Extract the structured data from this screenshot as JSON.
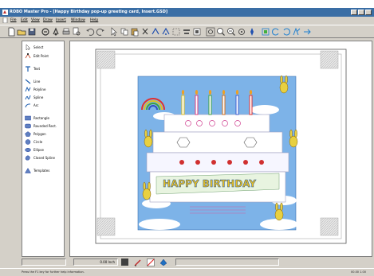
{
  "window": {
    "title": "ROBO Master Pro - [Happy Birthday pop-up greeting card, Insert.GSD]"
  },
  "menu": [
    {
      "key": "file",
      "label": "File"
    },
    {
      "key": "edit",
      "label": "Edit"
    },
    {
      "key": "view",
      "label": "View"
    },
    {
      "key": "draw",
      "label": "Draw"
    },
    {
      "key": "insert",
      "label": "Insert"
    },
    {
      "key": "window",
      "label": "Window"
    },
    {
      "key": "help",
      "label": "Help"
    }
  ],
  "toolbar": {
    "icons": [
      "new-file-icon",
      "open-folder-icon",
      "save-icon",
      "print-icon",
      "cutting-plotter-icon",
      "print-preview-icon",
      "zoom-page-icon",
      "undo-icon",
      "redo-icon",
      "select-arrow-icon",
      "copy-icon",
      "paste-icon",
      "cut-icon",
      "delete-icon",
      "group-icon",
      "ungroup-icon",
      "align-icon",
      "crop-icon",
      "zoom-fit-icon",
      "zoom-in-icon",
      "zoom-out-icon",
      "rotate-icon",
      "transform-icon",
      "node-left-icon",
      "node-right-icon",
      "connect-icon",
      "break-icon"
    ]
  },
  "sidebar": {
    "items": [
      {
        "key": "select",
        "label": "Select",
        "icon": "select-arrow-icon"
      },
      {
        "key": "edit-point",
        "label": "Edit Point",
        "icon": "edit-point-icon"
      },
      {
        "key": "text",
        "label": "Text",
        "icon": "text-tool-icon"
      },
      {
        "key": "line",
        "label": "Line",
        "icon": "line-tool-icon"
      },
      {
        "key": "polyline",
        "label": "Polyline",
        "icon": "polyline-tool-icon"
      },
      {
        "key": "spline",
        "label": "Spline",
        "icon": "spline-tool-icon"
      },
      {
        "key": "arc",
        "label": "Arc",
        "icon": "arc-tool-icon"
      },
      {
        "key": "rectangle",
        "label": "Rectangle",
        "icon": "rectangle-tool-icon"
      },
      {
        "key": "rounded-rect",
        "label": "Rounded Rect.",
        "icon": "rounded-rect-tool-icon"
      },
      {
        "key": "polygon",
        "label": "Polygon",
        "icon": "polygon-tool-icon"
      },
      {
        "key": "circle",
        "label": "Circle",
        "icon": "circle-tool-icon"
      },
      {
        "key": "ellipse",
        "label": "Ellipse",
        "icon": "ellipse-tool-icon"
      },
      {
        "key": "closed-spline",
        "label": "Closed Spline",
        "icon": "closed-spline-tool-icon"
      },
      {
        "key": "templates",
        "label": "Templates",
        "icon": "templates-icon"
      }
    ]
  },
  "canvas": {
    "artwork_text": "HAPPY BIRTHDAY",
    "candle_colors": [
      "#e0c020",
      "#e04080",
      "#40a040",
      "#d07020",
      "#4060d0",
      "#e03030"
    ]
  },
  "status": {
    "line_width": "0.00 Inch",
    "hint": "Press the F1 key for further help information.",
    "coords": "00.00  1.00"
  },
  "colors": {
    "titlebar": "#3a6ea5",
    "chrome": "#d4d0c8",
    "sky": "#7db3e8"
  }
}
